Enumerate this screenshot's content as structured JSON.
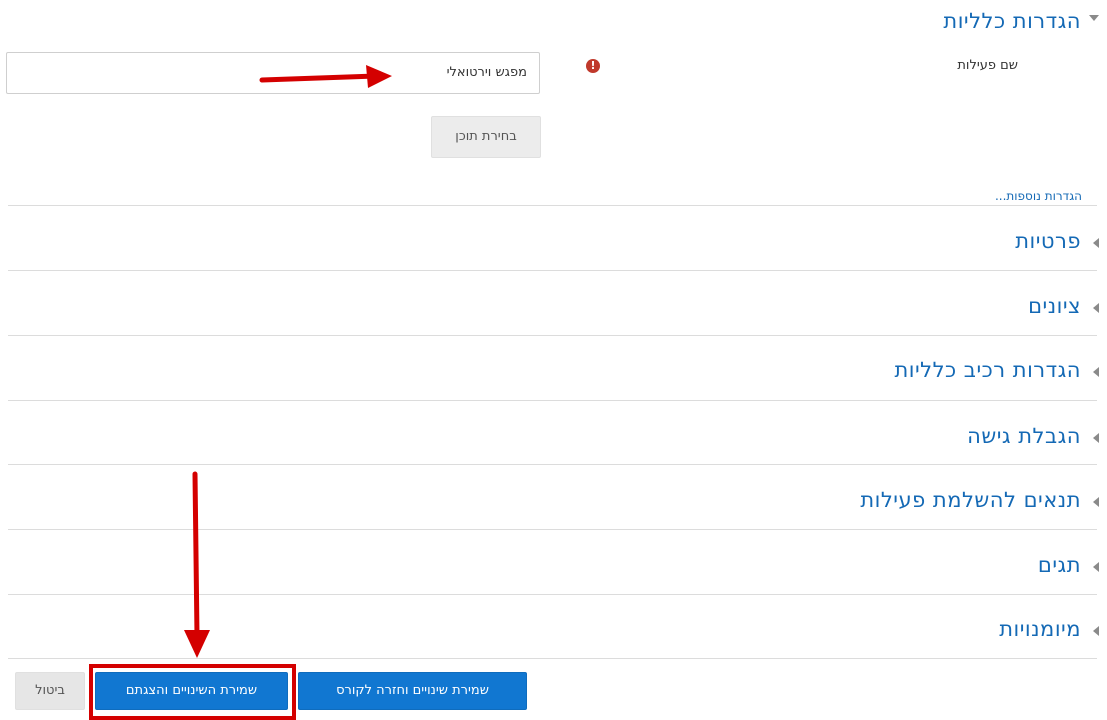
{
  "general": {
    "title": "הגדרות כלליות",
    "activity_name_label": "שם פעילות",
    "activity_name_value": "מפגש וירטואלי",
    "required_icon": "!",
    "choose_content_button": "בחירת תוכן",
    "more_settings_link": "הגדרות נוספות..."
  },
  "sections": [
    {
      "label": "פרטיות"
    },
    {
      "label": "ציונים"
    },
    {
      "label": "הגדרות רכיב כלליות"
    },
    {
      "label": "הגבלת גישה"
    },
    {
      "label": "תנאים להשלמת פעילות"
    },
    {
      "label": "תגים"
    },
    {
      "label": "מיומנויות"
    }
  ],
  "actions": {
    "save_return": "שמירת שינויים וחזרה לקורס",
    "save_display": "שמירת השינויים והצגתם",
    "cancel": "ביטול"
  },
  "annotation": {
    "arrow_color": "#d40000",
    "highlight_color": "#d40000"
  },
  "colors": {
    "accent": "#1469b5",
    "primary_button": "#1177d1"
  }
}
